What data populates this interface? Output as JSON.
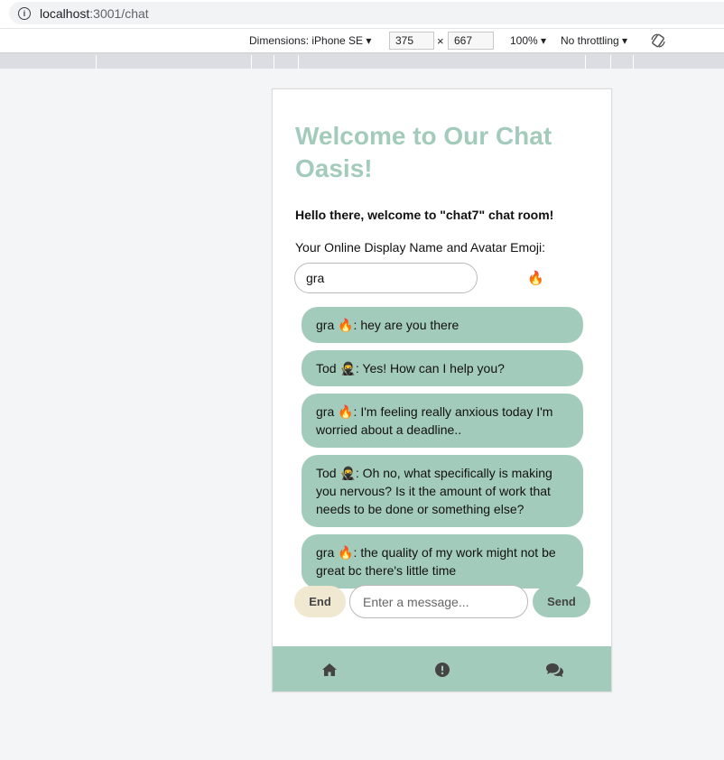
{
  "browser": {
    "url_host": "localhost",
    "url_path": ":3001/chat"
  },
  "devtools": {
    "dimensions_label": "Dimensions: iPhone SE",
    "width": "375",
    "height": "667",
    "times": "×",
    "zoom": "100%",
    "throttling": "No throttling",
    "caret": "▾"
  },
  "app": {
    "title": "Welcome to Our Chat Oasis!",
    "greeting": "Hello there, welcome to \"chat7\" chat room!",
    "name_label": "Your Online Display Name and Avatar Emoji:",
    "name_value": "gra",
    "avatar_emoji": "🔥",
    "messages": [
      {
        "text": "gra 🔥: hey are you there"
      },
      {
        "text": "Tod 🥷: Yes! How can I help you?"
      },
      {
        "text": "gra 🔥: I'm feeling really anxious today I'm worried about a deadline.."
      },
      {
        "text": "Tod 🥷: Oh no, what specifically is making you nervous? Is it the amount of work that needs to be done or something else?"
      },
      {
        "text": "gra 🔥: the quality of my work might not be great bc there's little time"
      }
    ],
    "end_label": "End",
    "message_placeholder": "Enter a message...",
    "send_label": "Send"
  },
  "nav": {
    "items": [
      {
        "icon": "home-icon"
      },
      {
        "icon": "alert-icon"
      },
      {
        "icon": "chat-bubbles-icon"
      }
    ]
  },
  "colors": {
    "accent": "#a3cbbb",
    "end_button": "#f0e8d0",
    "icon": "#444444"
  }
}
